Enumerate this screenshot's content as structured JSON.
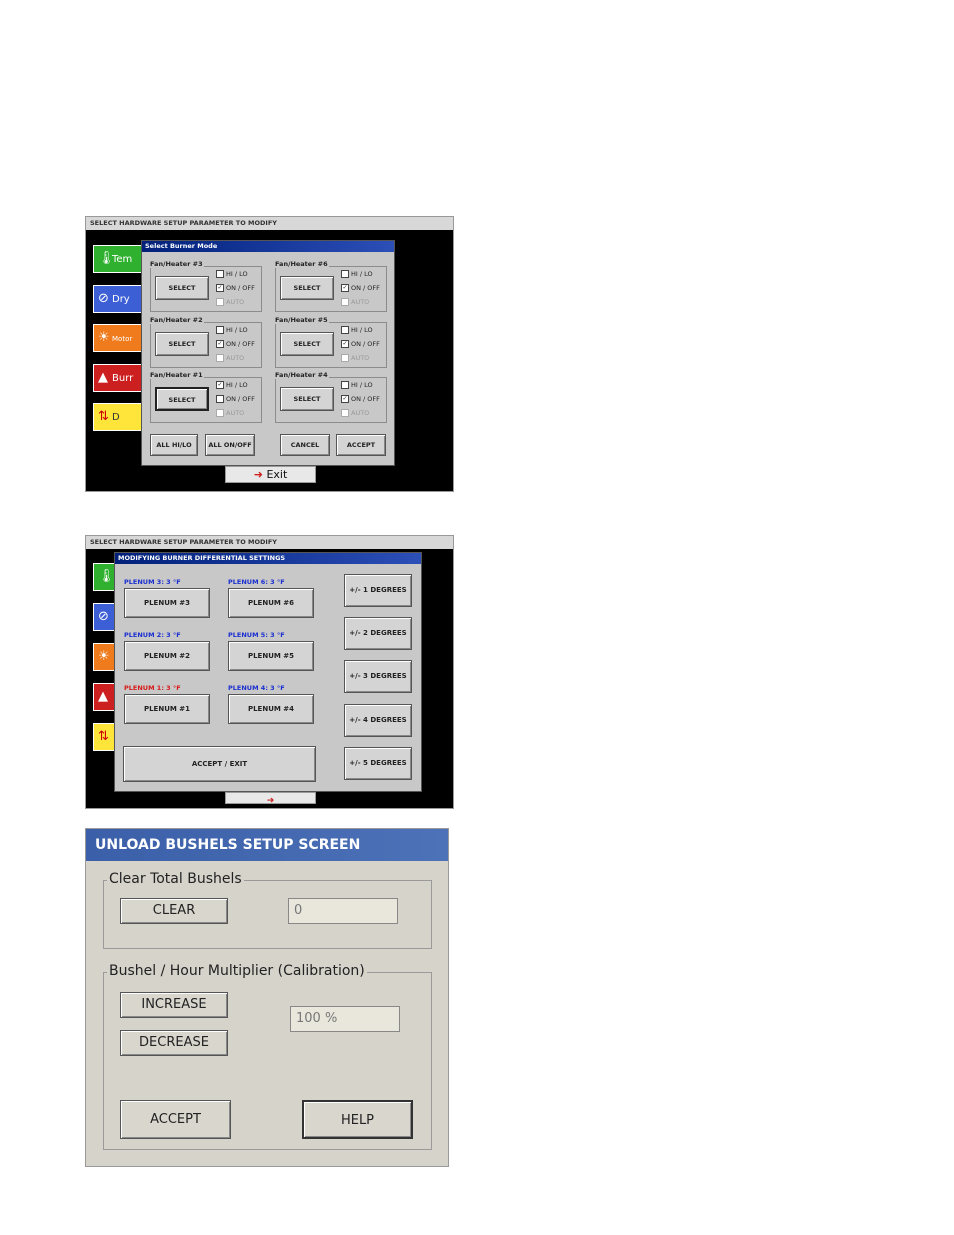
{
  "screen1": {
    "topbar": "SELECT HARDWARE SETUP PARAMETER TO MODIFY",
    "side_buttons": [
      {
        "label": "Tem",
        "icon": "thermometer-icon",
        "color": "#2fb12f"
      },
      {
        "label": "Dry",
        "icon": "dryer-icon",
        "color": "#3c5fd6"
      },
      {
        "label": "Motor",
        "icon": "sun-gear-icon",
        "color": "#ef7b1c"
      },
      {
        "label": "Burr",
        "icon": "burner-icon",
        "color": "#cc1f1f"
      },
      {
        "label": "D",
        "icon": "on-off-icon",
        "color": "#ffe53a"
      }
    ],
    "dialog_title": "Select Burner Mode",
    "groups": [
      {
        "label": "Fan/Heater #3",
        "select": "SELECT",
        "hilo": false,
        "onoff": true
      },
      {
        "label": "Fan/Heater #6",
        "select": "SELECT",
        "hilo": false,
        "onoff": true
      },
      {
        "label": "Fan/Heater #2",
        "select": "SELECT",
        "hilo": false,
        "onoff": true
      },
      {
        "label": "Fan/Heater #5",
        "select": "SELECT",
        "hilo": false,
        "onoff": true
      },
      {
        "label": "Fan/Heater #1",
        "select": "SELECT",
        "hilo": true,
        "onoff": false
      },
      {
        "label": "Fan/Heater #4",
        "select": "SELECT",
        "hilo": false,
        "onoff": true
      }
    ],
    "checkbox_labels": {
      "hilo": "HI / LO",
      "onoff": "ON / OFF",
      "auto": "AUTO"
    },
    "buttons": {
      "all_hilo": "ALL HI/LO",
      "all_onoff": "ALL ON/OFF",
      "cancel": "CANCEL",
      "accept": "ACCEPT"
    },
    "exit": "Exit"
  },
  "screen2": {
    "topbar": "SELECT HARDWARE SETUP PARAMETER TO MODIFY",
    "dialog_title": "MODIFYING BURNER DIFFERENTIAL SETTINGS",
    "plenums": [
      {
        "label": "PLENUM 3:  3 °F",
        "button": "PLENUM #3",
        "color": "#1a2fd0"
      },
      {
        "label": "PLENUM 6:  3 °F",
        "button": "PLENUM #6",
        "color": "#1a2fd0"
      },
      {
        "label": "PLENUM 2:  3 °F",
        "button": "PLENUM #2",
        "color": "#1a2fd0"
      },
      {
        "label": "PLENUM 5:  3 °F",
        "button": "PLENUM #5",
        "color": "#1a2fd0"
      },
      {
        "label": "PLENUM 1:  3 °F",
        "button": "PLENUM #1",
        "color": "#d81a1a"
      },
      {
        "label": "PLENUM 4:  3 °F",
        "button": "PLENUM #4",
        "color": "#1a2fd0"
      }
    ],
    "degrees": [
      "+/- 1 DEGREES",
      "+/- 2 DEGREES",
      "+/- 3 DEGREES",
      "+/- 4 DEGREES",
      "+/- 5 DEGREES"
    ],
    "accept_exit": "ACCEPT / EXIT"
  },
  "screen3": {
    "title": "UNLOAD BUSHELS SETUP SCREEN",
    "clear_group": "Clear Total Bushels",
    "clear_button": "CLEAR",
    "total_value": "0",
    "multiplier_group": "Bushel / Hour Multiplier (Calibration)",
    "increase_button": "INCREASE",
    "decrease_button": "DECREASE",
    "multiplier_value": "100 %",
    "accept_button": "ACCEPT",
    "help_button": "HELP"
  }
}
